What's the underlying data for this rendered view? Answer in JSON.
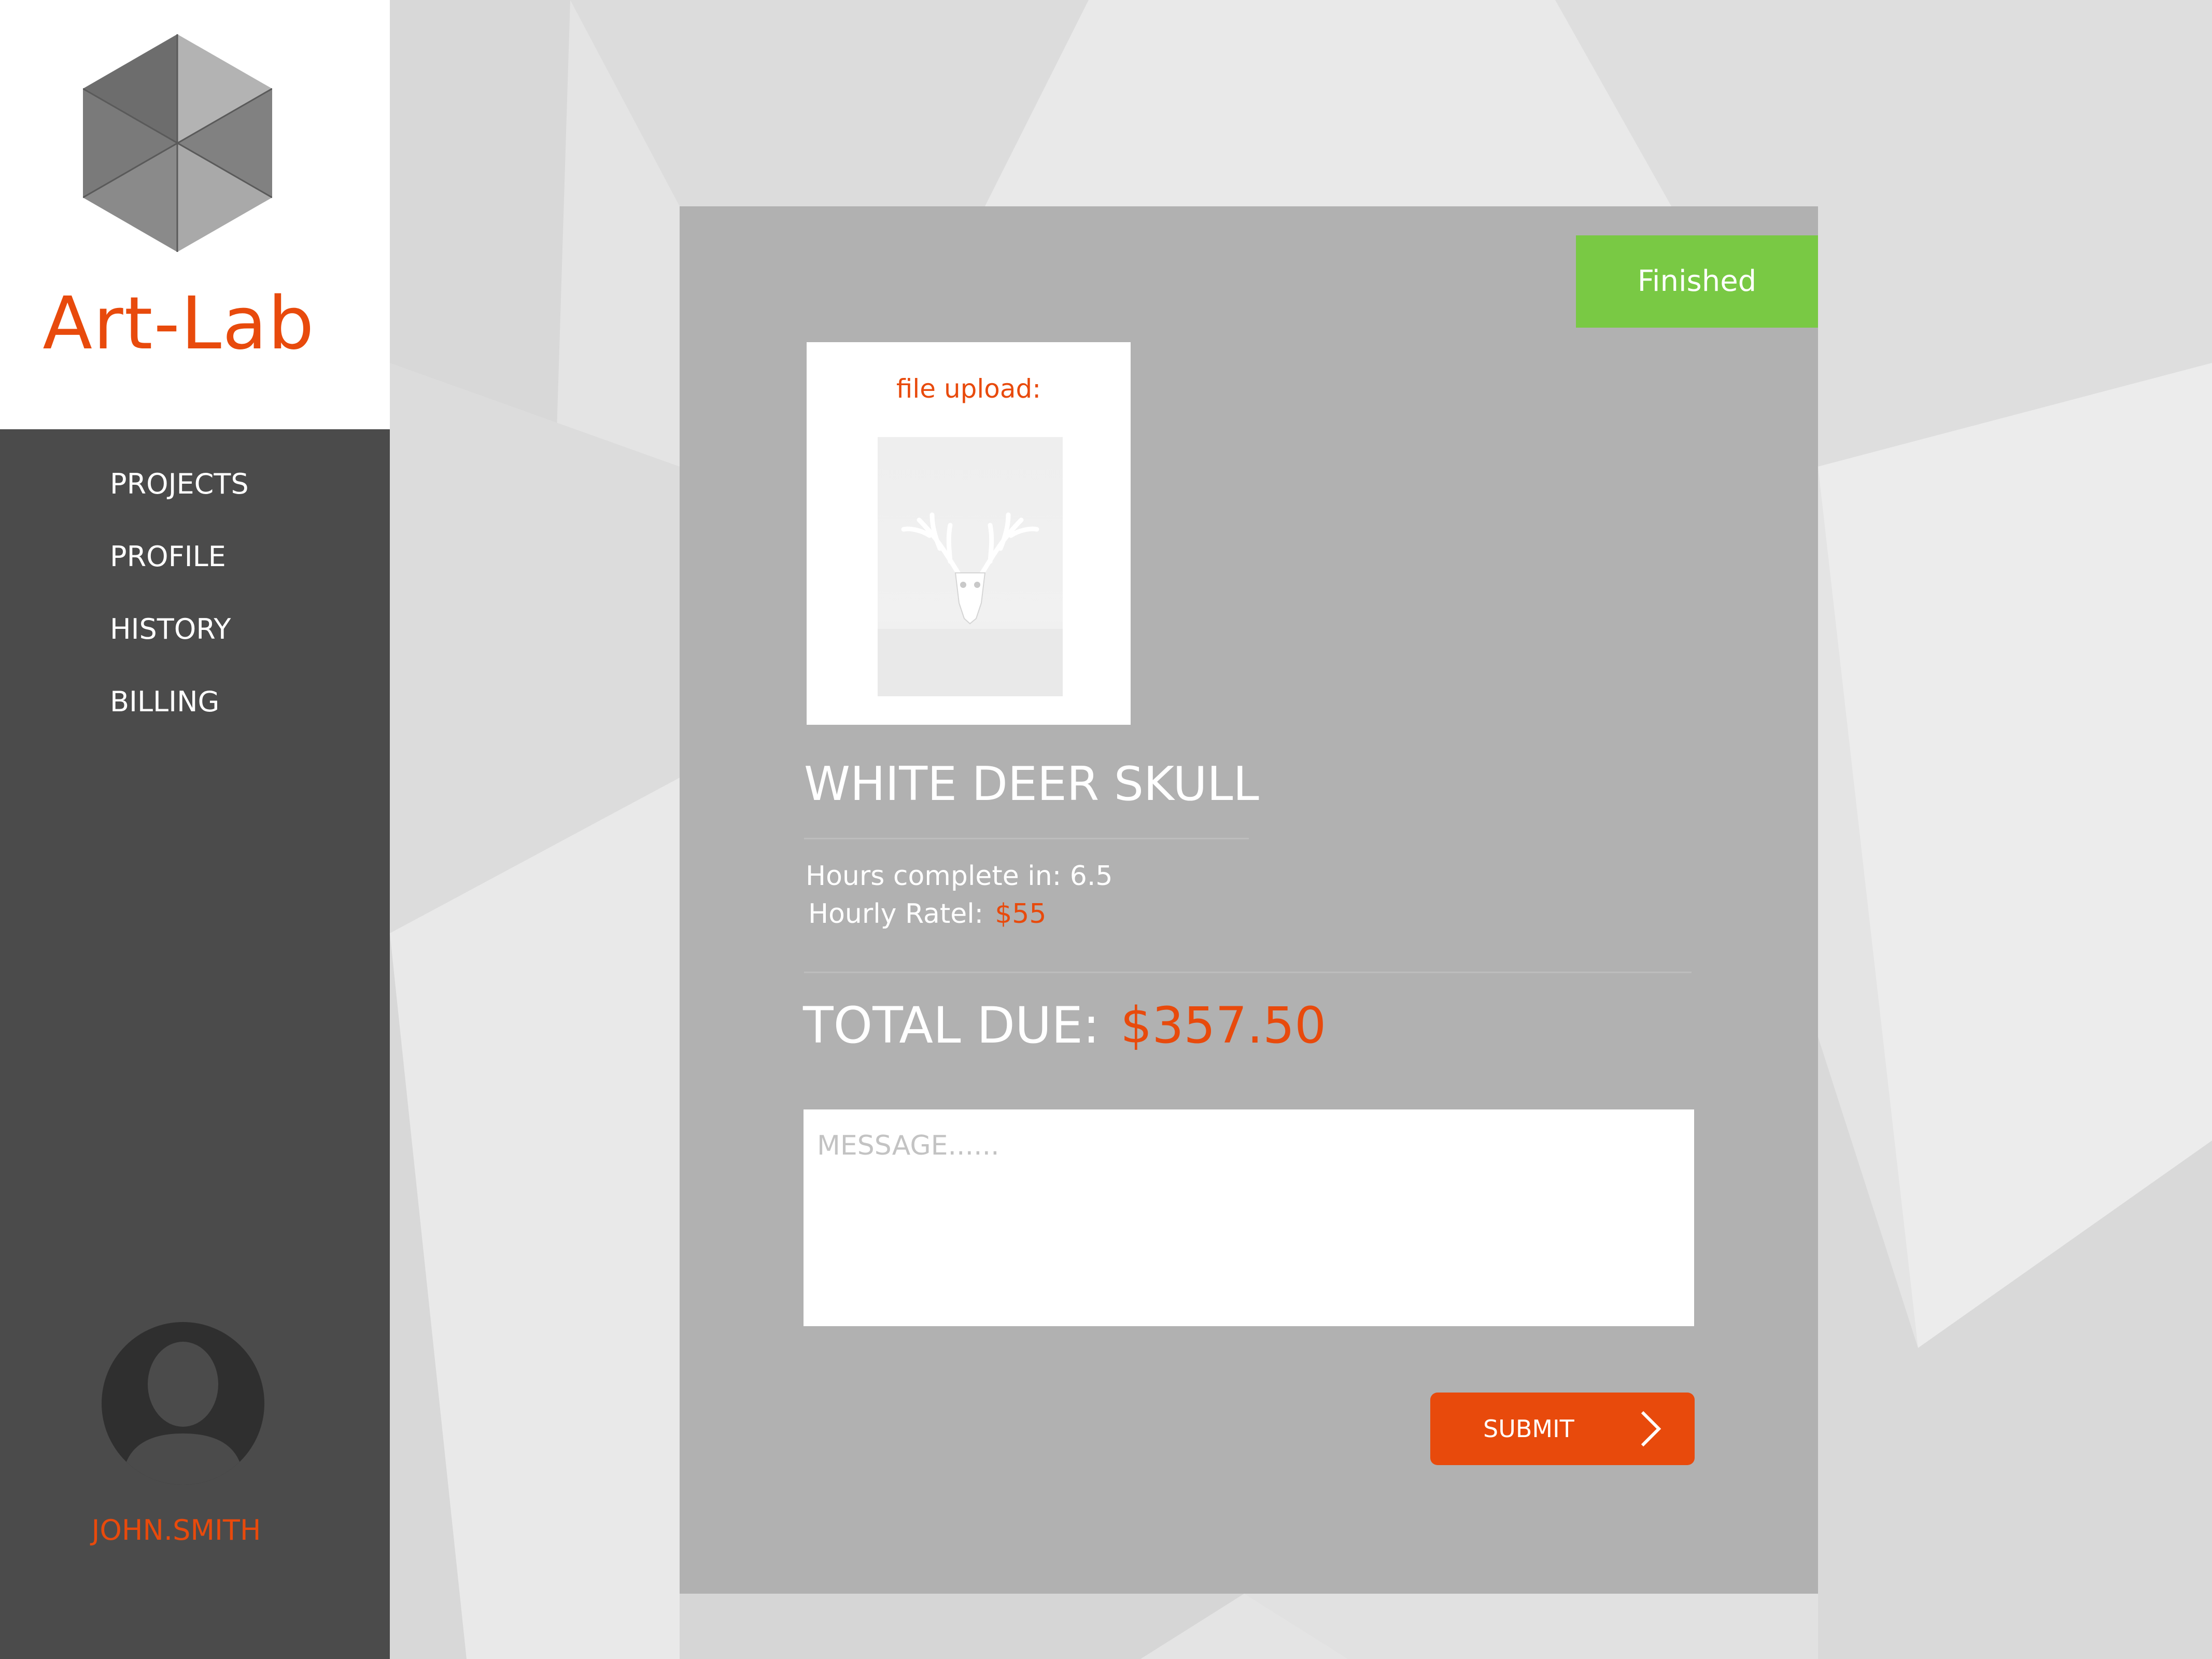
{
  "brand": {
    "name": "Art-Lab"
  },
  "sidebar": {
    "items": [
      {
        "label": "PROJECTS"
      },
      {
        "label": "PROFILE"
      },
      {
        "label": "HISTORY"
      },
      {
        "label": "BILLING"
      }
    ],
    "user": {
      "name": "JOHN.SMITH"
    }
  },
  "card": {
    "status": "Finished",
    "upload_label": "file upload:",
    "project_title": "WHITE DEER SKULL",
    "hours_text": "Hours complete in: 6.5",
    "rate_label": "Hourly Ratel:",
    "rate_value": "$55",
    "total_label": "TOTAL DUE:",
    "total_value": "$357.50",
    "message_placeholder": "MESSAGE......",
    "submit_label": "SUBMIT"
  },
  "icons": {
    "logo": "hexagon-logo-icon",
    "avatar": "user-silhouette-icon",
    "submit": "chevron-right-icon"
  },
  "colors": {
    "accent": "#e84a0c",
    "status": "#79c944",
    "sidebar": "#4b4b4b",
    "card": "#b1b1b1"
  }
}
